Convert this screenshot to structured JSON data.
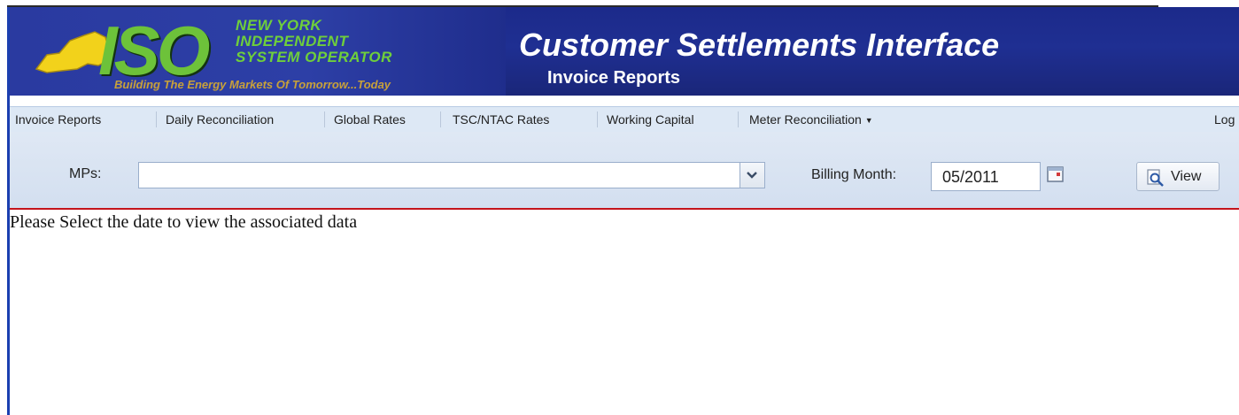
{
  "header": {
    "logo_abbrev": "ISO",
    "org_lines": [
      "NEW YORK",
      "INDEPENDENT",
      "SYSTEM OPERATOR"
    ],
    "tagline": "Building The Energy Markets Of Tomorrow...Today",
    "app_title": "Customer Settlements Interface",
    "page_subtitle": "Invoice Reports"
  },
  "nav": {
    "items": [
      {
        "label": "Invoice Reports"
      },
      {
        "label": "Daily Reconciliation"
      },
      {
        "label": "Global Rates"
      },
      {
        "label": "TSC/NTAC Rates"
      },
      {
        "label": "Working Capital"
      },
      {
        "label": "Meter Reconciliation"
      }
    ],
    "right_label": "Log"
  },
  "toolbar": {
    "mps_label": "MPs:",
    "mps_value": "",
    "billing_month_label": "Billing Month:",
    "billing_month_value": "05/2011",
    "view_label": "View"
  },
  "content": {
    "message": "Please Select the date to view the associated data"
  },
  "colors": {
    "banner": "#1f2f92",
    "logo_green": "#6dc23a",
    "tagline_gold": "#c8a13a",
    "nav_bg": "#dde8f5",
    "toolbar_bg": "#d8e3f1",
    "divider_red": "#c4151c"
  },
  "icons": {
    "dropdown": "chevron-down-icon",
    "calendar": "calendar-icon",
    "view": "magnifier-page-icon",
    "nav_caret": "caret-down-icon"
  }
}
